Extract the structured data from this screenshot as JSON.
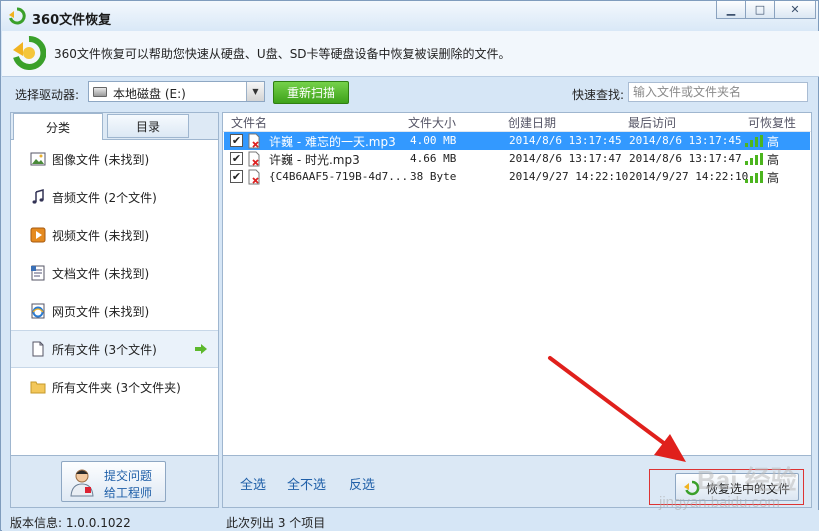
{
  "window": {
    "title": "360文件恢复",
    "controls": {
      "minimize": "▁",
      "maximize": "□",
      "close": "✕"
    }
  },
  "banner": {
    "text": "360文件恢复可以帮助您快速从硬盘、U盘、SD卡等硬盘设备中恢复被误删除的文件。"
  },
  "toolbar": {
    "drive_label": "选择驱动器:",
    "drive_value": "本地磁盘 (E:)",
    "rescan_label": "重新扫描",
    "quick_search_label": "快速查找:",
    "quick_search_placeholder": "输入文件或文件夹名"
  },
  "tabs": [
    {
      "label": "分类",
      "active": true
    },
    {
      "label": "目录",
      "active": false
    }
  ],
  "categories": [
    {
      "label": "图像文件 (未找到)",
      "icon": "image-icon"
    },
    {
      "label": "音频文件 (2个文件)",
      "icon": "music-icon"
    },
    {
      "label": "视频文件 (未找到)",
      "icon": "video-icon"
    },
    {
      "label": "文档文件 (未找到)",
      "icon": "document-icon"
    },
    {
      "label": "网页文件 (未找到)",
      "icon": "webpage-icon"
    },
    {
      "label": "所有文件 (3个文件)",
      "icon": "file-icon",
      "selected": true
    },
    {
      "label": "所有文件夹 (3个文件夹)",
      "icon": "folder-icon"
    }
  ],
  "help": {
    "line1": "提交问题",
    "line2": "给工程师"
  },
  "table": {
    "headers": [
      "文件名",
      "文件大小",
      "创建日期",
      "最后访问",
      "可恢复性"
    ],
    "rows": [
      {
        "name": "许巍 - 难忘的一天.mp3",
        "size": "4.00 MB",
        "created": "2014/8/6 13:17:45",
        "accessed": "2014/8/6 13:17:45",
        "recoverability": "高",
        "checked": "✔",
        "selected": true
      },
      {
        "name": "许巍 - 时光.mp3",
        "size": "4.66 MB",
        "created": "2014/8/6 13:17:47",
        "accessed": "2014/8/6 13:17:47",
        "recoverability": "高",
        "checked": "✔",
        "selected": false
      },
      {
        "name": "{C4B6AAF5-719B-4d7...",
        "size": "38 Byte",
        "created": "2014/9/27 14:22:10",
        "accessed": "2014/9/27 14:22:10",
        "recoverability": "高",
        "checked": "✔",
        "selected": false
      }
    ]
  },
  "bottom": {
    "select_all": "全选",
    "select_none": "全不选",
    "invert": "反选",
    "recover_label": "恢复选中的文件"
  },
  "status": {
    "version": "版本信息: 1.0.0.1022",
    "listed": "此次列出 3 个项目"
  },
  "watermark": {
    "line1": "Bai 经验",
    "line2": "jingyan.baidu.com"
  },
  "colors": {
    "selection": "#3399ff",
    "rescan_button": "#4fb827",
    "signal": "#4cb51f",
    "arrow": "#e0201c",
    "link": "#1f5fa8"
  }
}
